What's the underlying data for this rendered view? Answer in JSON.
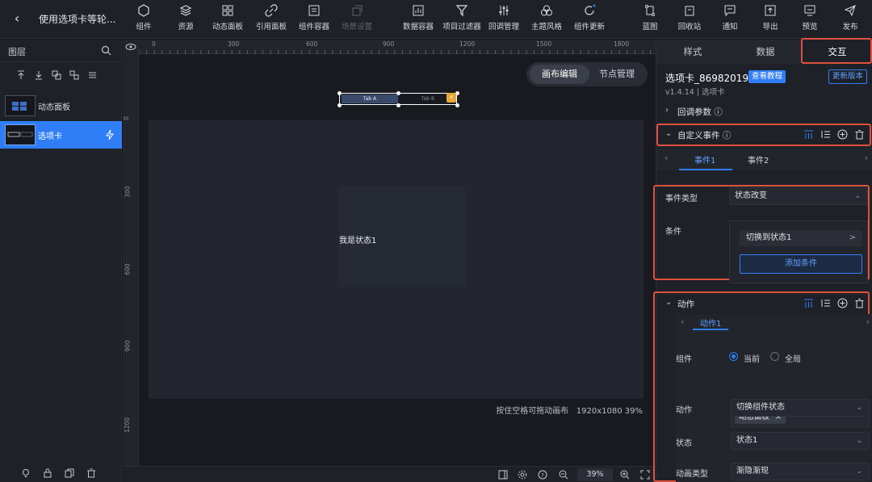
{
  "app": {
    "back_icon": "chevron-left-icon",
    "title": "使用选项卡等轮..."
  },
  "toolbar": [
    {
      "label": "组件",
      "icon": "component-icon"
    },
    {
      "label": "资源",
      "icon": "layers-icon"
    },
    {
      "label": "动态面板",
      "icon": "grid-icon"
    },
    {
      "label": "引用面板",
      "icon": "link-icon"
    },
    {
      "label": "组件容器",
      "icon": "container-icon"
    },
    {
      "label": "场景设置",
      "icon": "scene-icon"
    },
    {
      "label": "数据容器",
      "icon": "chart-icon"
    },
    {
      "label": "项目过滤器",
      "icon": "filter-icon"
    },
    {
      "label": "回调管理",
      "icon": "sliders-icon"
    },
    {
      "label": "主题风格",
      "icon": "palette-icon"
    },
    {
      "label": "组件更新",
      "icon": "refresh-icon"
    },
    {
      "label": "蓝图",
      "icon": "blueprint-icon"
    },
    {
      "label": "回收站",
      "icon": "trash-icon"
    },
    {
      "label": "通知",
      "icon": "message-icon"
    },
    {
      "label": "导出",
      "icon": "export-icon"
    },
    {
      "label": "预览",
      "icon": "monitor-icon"
    },
    {
      "label": "发布",
      "icon": "send-icon"
    }
  ],
  "layers_panel": {
    "title": "图层",
    "items": [
      {
        "label": "动态面板"
      },
      {
        "label": "选项卡"
      }
    ]
  },
  "canvas": {
    "ruler_h": [
      "0",
      "300",
      "600",
      "900",
      "1200",
      "1500",
      "1800"
    ],
    "ruler_v": [
      "0",
      "300",
      "600",
      "900",
      "1200"
    ],
    "mode_edit": "画布编辑",
    "mode_nodes": "节点管理",
    "tab_a": "Tab A",
    "tab_b": "Tab B",
    "state_text": "我是状态1",
    "hint": "按住空格可拖动画布",
    "resolution": "1920x1080 39%",
    "zoom": "39%"
  },
  "right_panel": {
    "tabs": [
      "样式",
      "数据",
      "交互"
    ],
    "component_name": "选项卡_86982019",
    "tutorial": "查看教程",
    "update_version": "更新版本",
    "version": "v1.4.14 | 选项卡",
    "callback_params": "回调参数",
    "custom_events": "自定义事件",
    "event_tabs": [
      "事件1",
      "事件2"
    ],
    "event_type_label": "事件类型",
    "event_type_value": "状态改变",
    "condition_label": "条件",
    "condition_item": "切换到状态1",
    "add_condition": "添加条件",
    "actions_section": "动作",
    "action_tab": "动作1",
    "component_label": "组件",
    "radio_current": "当前",
    "radio_global": "全局",
    "chip": "动态面板",
    "action_label": "动作",
    "action_value": "切换组件状态",
    "state_label": "状态",
    "state_value": "状态1",
    "anim_label": "动画类型",
    "anim_value": "渐隐渐现"
  }
}
